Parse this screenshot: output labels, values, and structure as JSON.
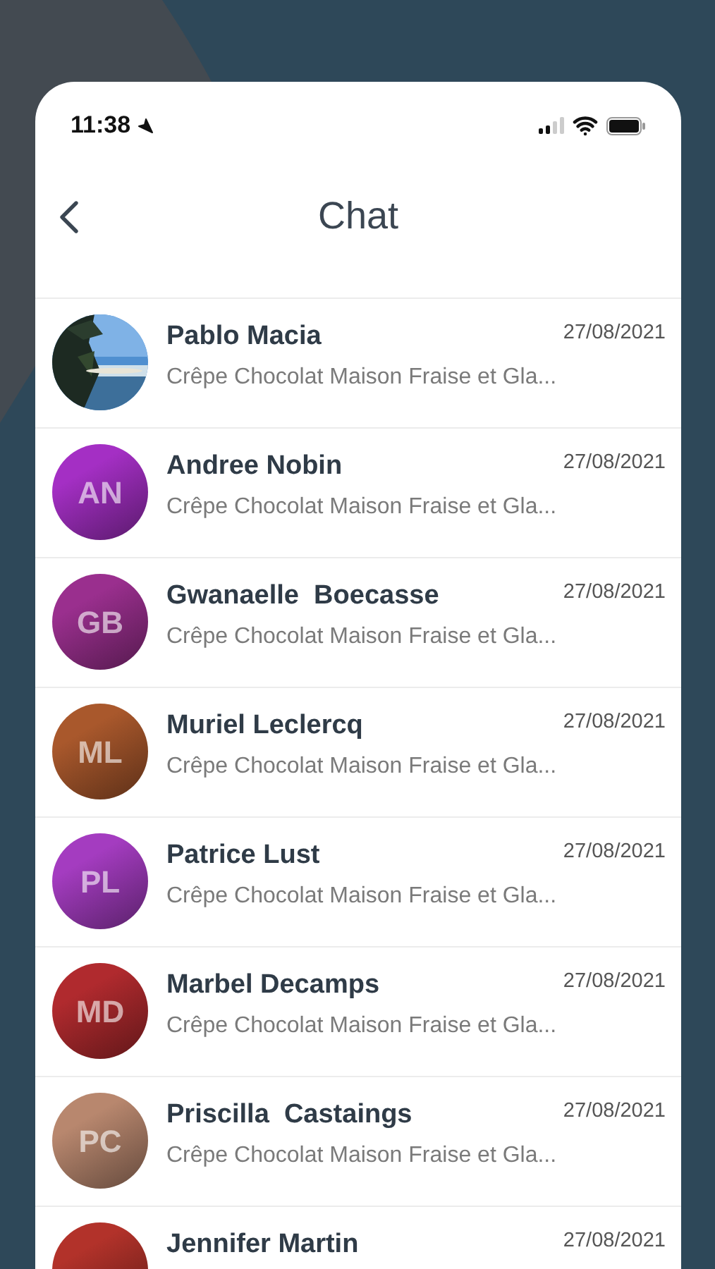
{
  "status_bar": {
    "time": "11:38"
  },
  "header": {
    "title": "Chat"
  },
  "conversations": [
    {
      "name": "Pablo Macia",
      "message": "Crêpe Chocolat Maison Fraise et Gla...",
      "date": "27/08/2021"
    },
    {
      "name": "Andree Nobin",
      "message": "Crêpe Chocolat Maison Fraise et Gla...",
      "date": "27/08/2021",
      "avatar": {
        "kind": "initials",
        "initials": "AN",
        "color": "#a42fc4"
      }
    },
    {
      "name": "Gwanaelle  Boecasse",
      "message": "Crêpe Chocolat Maison Fraise et Gla...",
      "date": "27/08/2021",
      "avatar": {
        "kind": "initials",
        "initials": "GB",
        "color": "#9a2f8e"
      }
    },
    {
      "name": "Muriel Leclercq",
      "message": "Crêpe Chocolat Maison Fraise et Gla...",
      "date": "27/08/2021",
      "avatar": {
        "kind": "initials",
        "initials": "ML",
        "color": "#a9582c"
      }
    },
    {
      "name": "Patrice Lust",
      "message": "Crêpe Chocolat Maison Fraise et Gla...",
      "date": "27/08/2021",
      "avatar": {
        "kind": "initials",
        "initials": "PL",
        "color": "#a43cc0"
      }
    },
    {
      "name": "Marbel Decamps",
      "message": "Crêpe Chocolat Maison Fraise et Gla...",
      "date": "27/08/2021",
      "avatar": {
        "kind": "initials",
        "initials": "MD",
        "color": "#b02a2e"
      }
    },
    {
      "name": "Priscilla  Castaings",
      "message": "Crêpe Chocolat Maison Fraise et Gla...",
      "date": "27/08/2021",
      "avatar": {
        "kind": "initials",
        "initials": "PC",
        "color": "#b8876e"
      }
    },
    {
      "name": "Jennifer Martin",
      "date": "27/08/2021",
      "avatar": {
        "kind": "initials",
        "color": "#b2322a"
      }
    }
  ]
}
